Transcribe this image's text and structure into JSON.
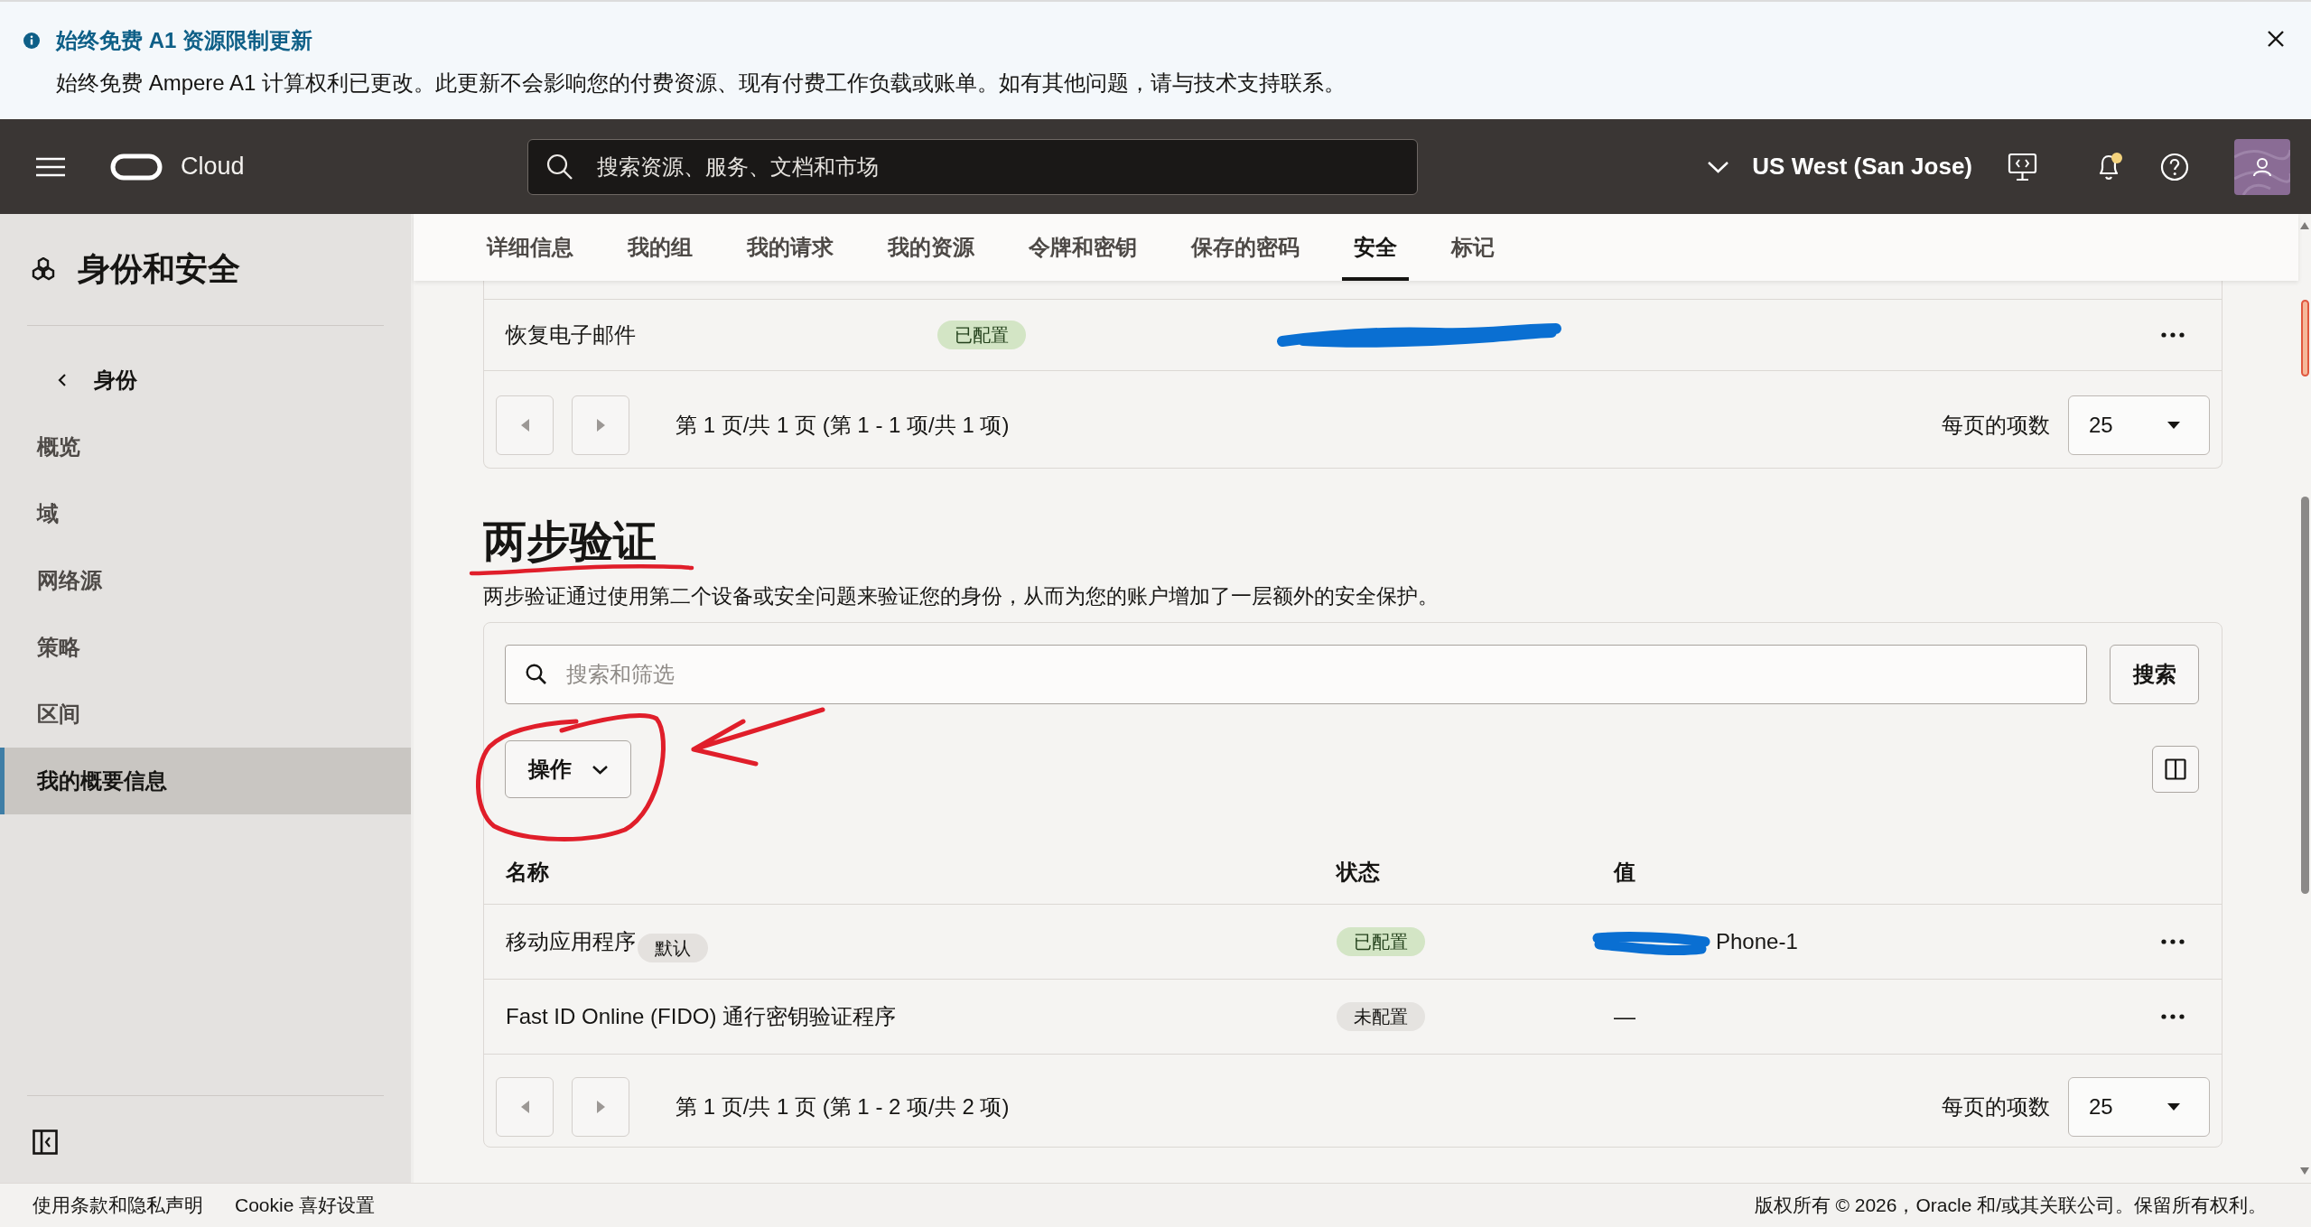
{
  "banner": {
    "title": "始终免费 A1 资源限制更新",
    "message": "始终免费 Ampere A1 计算权利已更改。此更新不会影响您的付费资源、现有付费工作负载或账单。如有其他问题，请与技术支持联系。"
  },
  "header": {
    "brand": "Cloud",
    "search": {
      "placeholder": "搜索资源、服务、文档和市场"
    },
    "region": "US West (San Jose)",
    "notifications": {
      "unread": true
    }
  },
  "sidebar": {
    "title": "身份和安全",
    "back": "身份",
    "items": [
      {
        "label": "概览",
        "selected": false
      },
      {
        "label": "域",
        "selected": false
      },
      {
        "label": "网络源",
        "selected": false
      },
      {
        "label": "策略",
        "selected": false
      },
      {
        "label": "区间",
        "selected": false
      },
      {
        "label": "我的概要信息",
        "selected": true
      }
    ]
  },
  "tabs": [
    {
      "label": "详细信息",
      "selected": false
    },
    {
      "label": "我的组",
      "selected": false
    },
    {
      "label": "我的请求",
      "selected": false
    },
    {
      "label": "我的资源",
      "selected": false
    },
    {
      "label": "令牌和密钥",
      "selected": false
    },
    {
      "label": "保存的密码",
      "selected": false
    },
    {
      "label": "安全",
      "selected": true
    },
    {
      "label": "标记",
      "selected": false
    }
  ],
  "recovery_table": {
    "rows": [
      {
        "name": "恢复电子邮件",
        "status": {
          "label": "已配置",
          "configured": true
        },
        "value": {
          "redacted": true
        }
      }
    ],
    "pagination": {
      "prev_disabled": true,
      "next_disabled": true,
      "summary": "第 1 页/共 1 页 (第 1 - 1 项/共 1 项)",
      "page_size_label": "每页的项数",
      "page_size": "25"
    }
  },
  "two_step": {
    "title": "两步验证",
    "description": "两步验证通过使用第二个设备或安全问题来验证您的身份，从而为您的账户增加了一层额外的安全保护。",
    "search": {
      "placeholder": "搜索和筛选"
    },
    "search_button": "搜索",
    "actions_button": "操作",
    "columns": [
      "名称",
      "状态",
      "值"
    ],
    "rows": [
      {
        "name": "移动应用程序",
        "tag": "默认",
        "status": {
          "label": "已配置",
          "configured": true
        },
        "value": {
          "redacted": true,
          "text": "Phone-1"
        }
      },
      {
        "name": "Fast ID Online (FIDO) 通行密钥验证程序",
        "status": {
          "label": "未配置",
          "configured": false
        },
        "value": {
          "redacted": false,
          "text": "—"
        }
      }
    ],
    "pagination": {
      "prev_disabled": true,
      "next_disabled": true,
      "summary": "第 1 页/共 1 页 (第 1 - 2 项/共 2 项)",
      "page_size_label": "每页的项数",
      "page_size": "25"
    }
  },
  "footer": {
    "links": [
      "使用条款和隐私声明",
      "Cookie 喜好设置"
    ],
    "copyright": "版权所有 © 2026，Oracle 和/或其关联公司。保留所有权利。"
  }
}
